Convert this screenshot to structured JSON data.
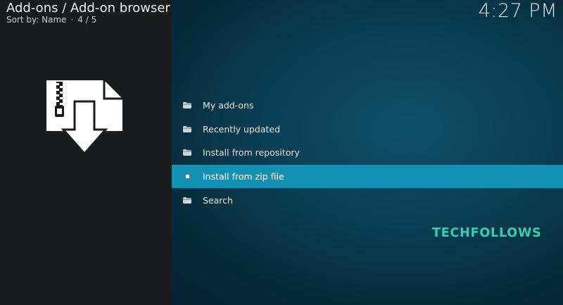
{
  "header": {
    "title": "Add-ons / Add-on browser",
    "sort_label": "Sort by: Name",
    "position": "4 / 5",
    "separator": "·"
  },
  "clock": "4:27 PM",
  "menu": {
    "items": [
      {
        "label": "My add-ons",
        "icon": "folder-icon",
        "selected": false
      },
      {
        "label": "Recently updated",
        "icon": "folder-icon",
        "selected": false
      },
      {
        "label": "Install from repository",
        "icon": "folder-icon",
        "selected": false
      },
      {
        "label": "Install from zip file",
        "icon": "square-icon",
        "selected": true
      },
      {
        "label": "Search",
        "icon": "folder-icon",
        "selected": false
      }
    ]
  },
  "watermark": "TECHFOLLOWS",
  "colors": {
    "left_panel": "#1a1b1c",
    "selected_item": "#1291b5",
    "watermark": "#2ed3b4"
  }
}
